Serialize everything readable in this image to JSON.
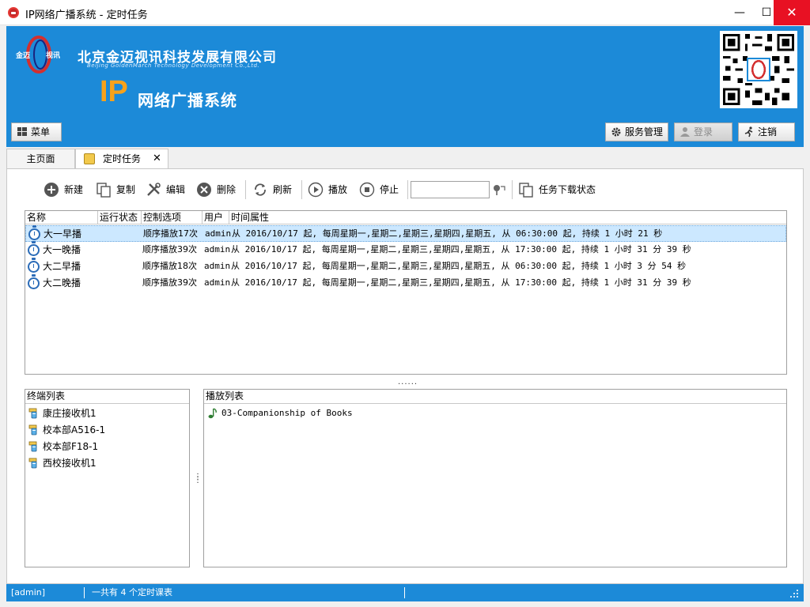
{
  "window": {
    "title": "IP网络广播系统  -  定时任务",
    "min_glyph": "—",
    "max_glyph": "☐",
    "close_glyph": "✕"
  },
  "banner": {
    "logo_left": "金迈",
    "logo_right": "视讯",
    "company_cn": "北京金迈视讯科技发展有限公司",
    "company_en": "Beijing GoldenMarch Technology Development Co.,Ltd.",
    "brand_ip": "IP",
    "brand_system": "网络广播系统",
    "menu_label": "菜单",
    "service_label": "服务管理",
    "login_label": "登录",
    "logout_label": "注销"
  },
  "tabs": {
    "home_label": "主页面",
    "schedule_label": "定时任务",
    "close_glyph": "✕"
  },
  "toolbar": {
    "new_label": "新建",
    "copy_label": "复制",
    "edit_label": "编辑",
    "delete_label": "删除",
    "refresh_label": "刷新",
    "play_label": "播放",
    "stop_label": "停止",
    "search_value": "",
    "download_status_label": "任务下载状态"
  },
  "task_table": {
    "columns": [
      "名称",
      "运行状态",
      "控制选项",
      "用户",
      "时间属性"
    ],
    "rows": [
      {
        "name": "大一早播",
        "status": "",
        "control": "顺序播放17次",
        "user": "admin",
        "time": "从 2016/10/17 起, 每周星期一,星期二,星期三,星期四,星期五, 从 06:30:00 起, 持续 1 小时 21 秒",
        "selected": true
      },
      {
        "name": "大一晚播",
        "status": "",
        "control": "顺序播放39次",
        "user": "admin",
        "time": "从 2016/10/17 起, 每周星期一,星期二,星期三,星期四,星期五, 从 17:30:00 起, 持续 1 小时 31 分 39 秒",
        "selected": false
      },
      {
        "name": "大二早播",
        "status": "",
        "control": "顺序播放18次",
        "user": "admin",
        "time": "从 2016/10/17 起, 每周星期一,星期二,星期三,星期四,星期五, 从 06:30:00 起, 持续 1 小时 3 分 54 秒",
        "selected": false
      },
      {
        "name": "大二晚播",
        "status": "",
        "control": "顺序播放39次",
        "user": "admin",
        "time": "从 2016/10/17 起, 每周星期一,星期二,星期三,星期四,星期五, 从 17:30:00 起, 持续 1 小时 31 分 39 秒",
        "selected": false
      }
    ]
  },
  "splitter": {
    "dots": "......",
    "vdots": "⋮"
  },
  "terminal_list": {
    "header": "终端列表",
    "items": [
      "康庄接收机1",
      "校本部A516-1",
      "校本部F18-1",
      "西校接收机1"
    ]
  },
  "play_list": {
    "header": "播放列表",
    "items": [
      "03-Companionship of Books"
    ]
  },
  "statusbar": {
    "user": "[admin]",
    "count_text": "一共有 4 个定时课表"
  },
  "colors": {
    "banner_blue": "#1c8ad8",
    "brand_orange": "#f7a21b",
    "close_red": "#e81123",
    "selection": "#cce8ff"
  },
  "icons": {
    "menu": "windows-logo-icon",
    "service": "gear-icon",
    "login": "user-icon",
    "logout": "running-man-icon",
    "task": "stopwatch-icon",
    "terminal": "receiver-icon",
    "track": "music-note-icon"
  }
}
